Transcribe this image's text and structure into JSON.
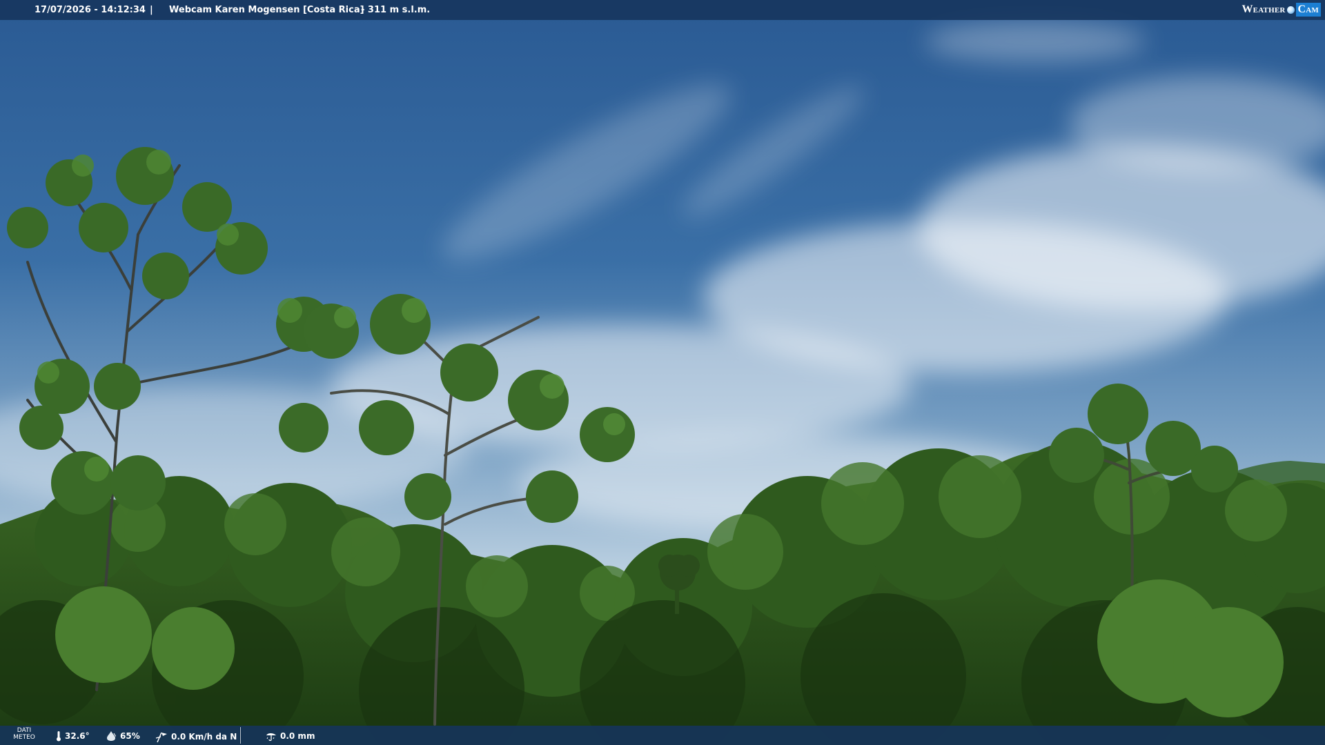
{
  "header": {
    "timestamp": "17/07/2026 - 14:12:34",
    "separator": "|",
    "camera_title": "Webcam Karen Mogensen [Costa Rica]",
    "altitude": "- 311 m s.l.m.",
    "logo": {
      "part1": "Weather",
      "part2": "Cam"
    }
  },
  "footer": {
    "label_line1": "DATI",
    "label_line2": "METEO",
    "temperature": "32.6°",
    "humidity": "65%",
    "wind": "0.0 Km/h da N",
    "rain": "0.0 mm"
  },
  "colors": {
    "bar": "#16345c",
    "sky_top": "#2a5b95",
    "sky_bottom": "#c9dbe8",
    "foliage": "#2f5a1e",
    "logo_accent": "#1c7fd3"
  },
  "icons": {
    "temperature": "thermometer-icon",
    "humidity": "humidity-drop-icon",
    "wind": "wind-vane-icon",
    "rain": "rain-gauge-icon"
  }
}
